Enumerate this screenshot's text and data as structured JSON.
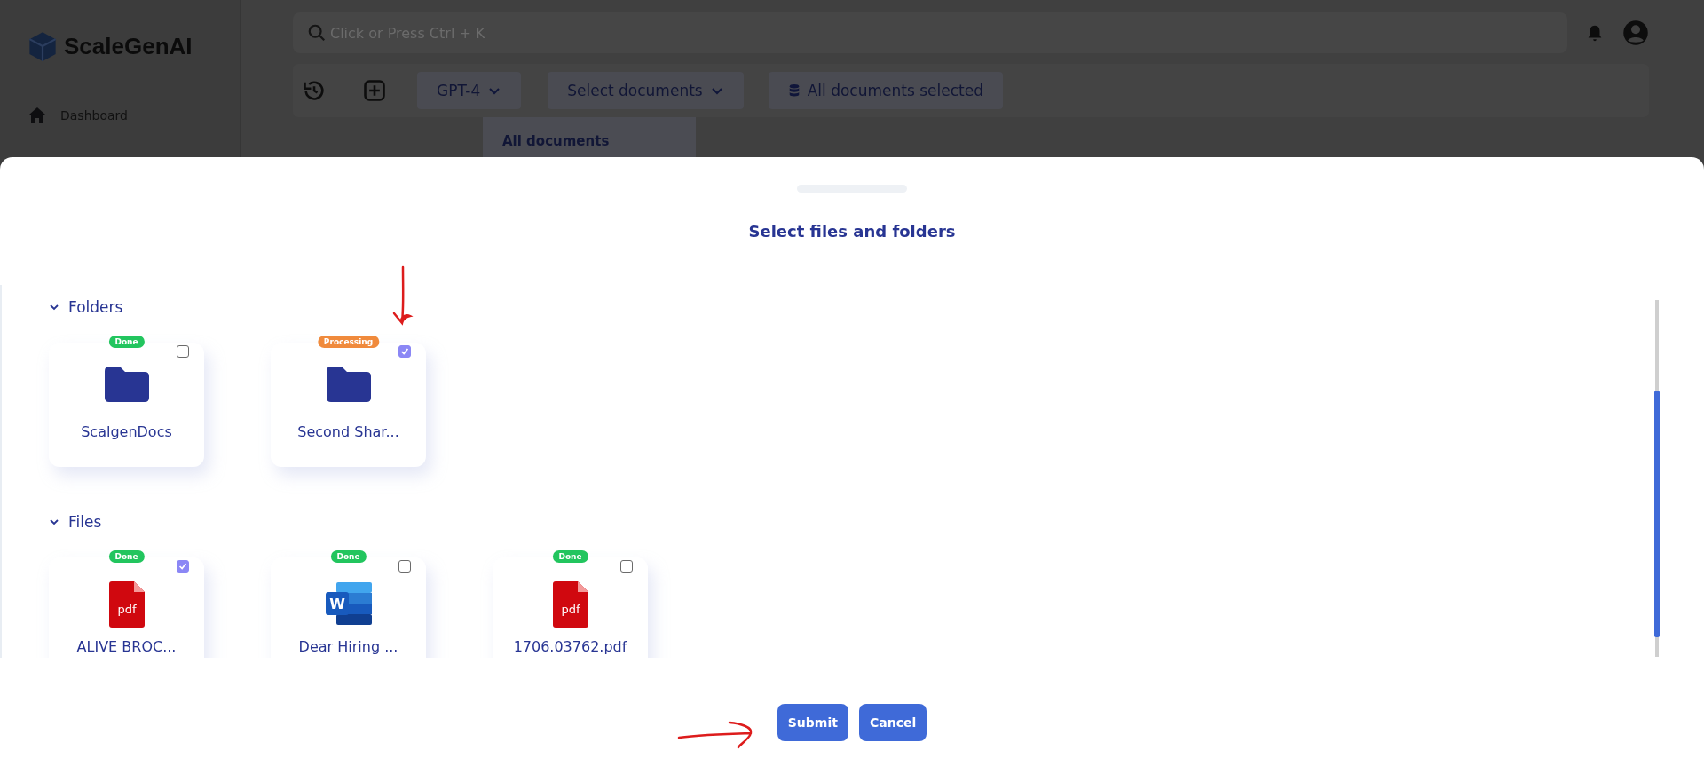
{
  "sidebar": {
    "brand": "ScaleGenAI",
    "items": [
      {
        "label": "Dashboard"
      }
    ]
  },
  "search": {
    "placeholder": "Click or Press Ctrl + K"
  },
  "toolbar": {
    "model": "GPT-4",
    "documents_dropdown": "Select documents",
    "documents_status": "All documents selected"
  },
  "dropdown_menu": {
    "items": [
      {
        "label": "All documents"
      }
    ]
  },
  "modal": {
    "title": "Select files and folders",
    "sections": [
      {
        "title": "Folders",
        "expanded": true,
        "items": [
          {
            "kind": "folder",
            "name": "ScalgenDocs",
            "status": {
              "label": "Done",
              "color": "#22c55e"
            },
            "checked": false
          },
          {
            "kind": "folder",
            "name": "Second Shar...",
            "status": {
              "label": "Processing",
              "color": "#f08a3c"
            },
            "checked": true
          }
        ]
      },
      {
        "title": "Files",
        "expanded": true,
        "items": [
          {
            "kind": "pdf",
            "icon_text": "pdf",
            "name": "ALIVE BROC...",
            "status": {
              "label": "Done",
              "color": "#22c55e"
            },
            "checked": true
          },
          {
            "kind": "word",
            "icon_text": "W",
            "name": "Dear Hiring ...",
            "status": {
              "label": "Done",
              "color": "#22c55e"
            },
            "checked": false
          },
          {
            "kind": "pdf",
            "icon_text": "pdf",
            "name": "1706.03762.pdf",
            "status": {
              "label": "Done",
              "color": "#22c55e"
            },
            "checked": false
          }
        ]
      }
    ],
    "buttons": [
      {
        "label": "Submit"
      },
      {
        "label": "Cancel"
      }
    ]
  }
}
